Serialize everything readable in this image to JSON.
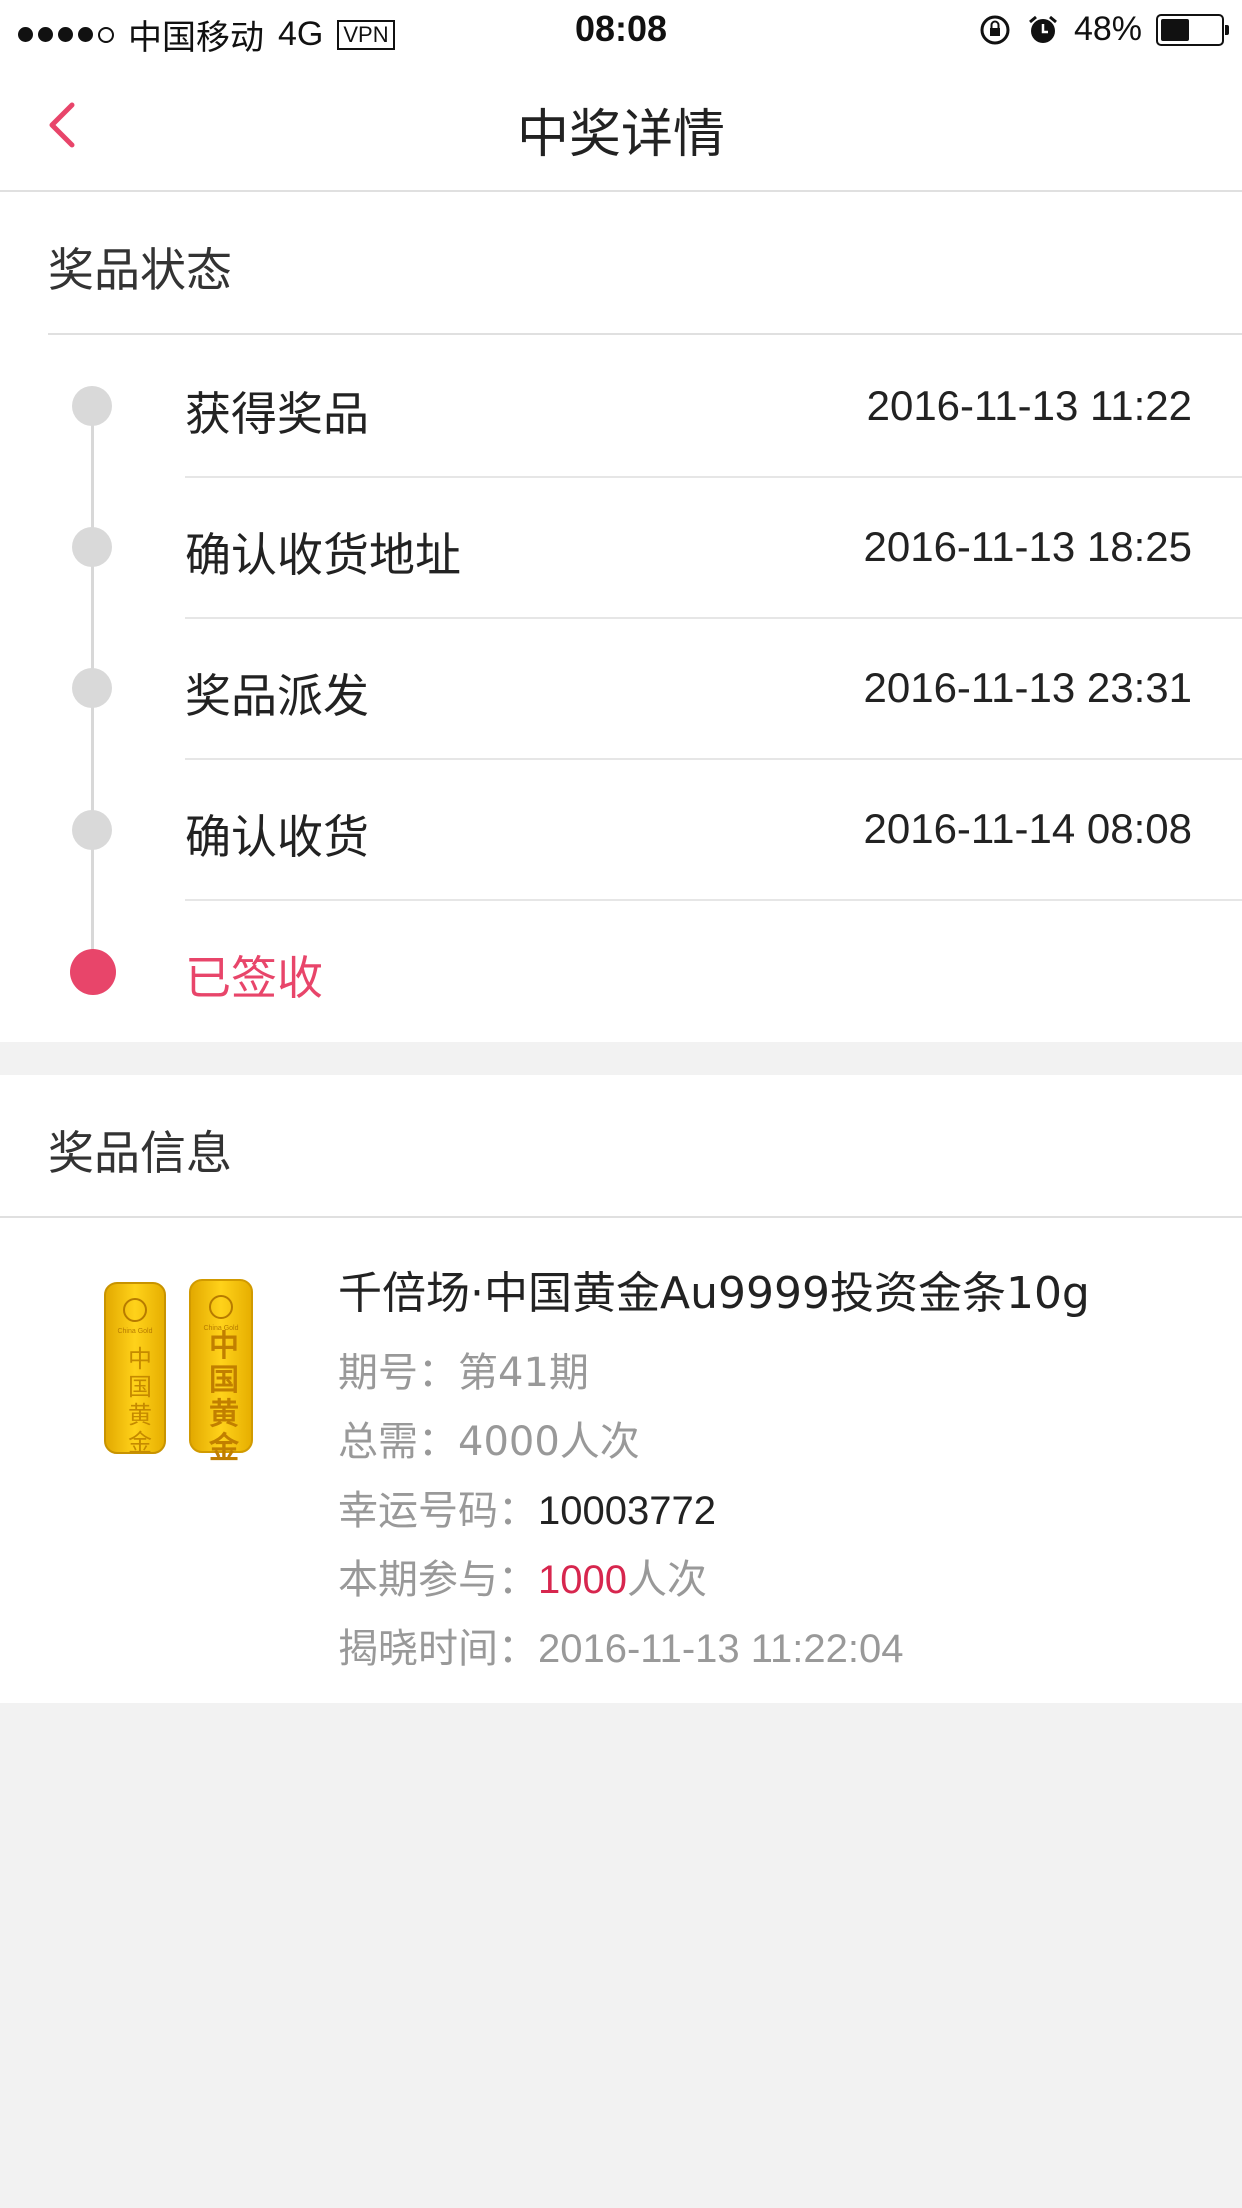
{
  "status_bar": {
    "carrier": "中国移动",
    "network": "4G",
    "vpn": "VPN",
    "time": "08:08",
    "battery": "48%",
    "battery_level": 0.48
  },
  "nav": {
    "title": "中奖详情"
  },
  "prize_status": {
    "title": "奖品状态",
    "steps": [
      {
        "label": "获得奖品",
        "time": "2016-11-13 11:22"
      },
      {
        "label": "确认收货地址",
        "time": "2016-11-13 18:25"
      },
      {
        "label": "奖品派发",
        "time": "2016-11-13 23:31"
      },
      {
        "label": "确认收货",
        "time": "2016-11-14 08:08"
      },
      {
        "label": "已签收",
        "time": ""
      }
    ]
  },
  "prize_info": {
    "title": "奖品信息",
    "name": "千倍场·中国黄金Au9999投资金条10g",
    "period_label": "期号：",
    "period_value": "第41期",
    "total_label": "总需：",
    "total_value": "4000人次",
    "lucky_label": "幸运号码：",
    "lucky_value": "10003772",
    "join_label": "本期参与：",
    "join_count": "1000",
    "join_unit": "人次",
    "reveal_label": "揭晓时间：",
    "reveal_value": "2016-11-13 11:22:04",
    "bar_text_1": "中国黄金",
    "bar_text_2": "中国黄金"
  },
  "colors": {
    "accent": "#e8456a",
    "highlight": "#d7264e",
    "gold": "#f5c400"
  }
}
